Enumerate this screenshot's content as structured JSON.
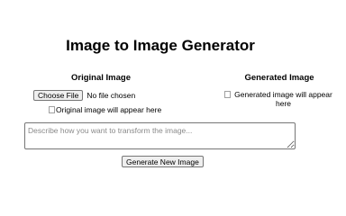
{
  "page": {
    "title": "Image to Image Generator"
  },
  "original": {
    "heading": "Original Image",
    "file_button_label": "Choose File",
    "file_status": "No file chosen",
    "image_placeholder": "Original image will appear here"
  },
  "generated": {
    "heading": "Generated Image",
    "image_placeholder": "Generated image will appear here"
  },
  "prompt": {
    "value": "",
    "placeholder": "Describe how you want to transform the image..."
  },
  "actions": {
    "generate_label": "Generate New Image"
  },
  "icons": {
    "broken_image": "broken-image-icon"
  }
}
